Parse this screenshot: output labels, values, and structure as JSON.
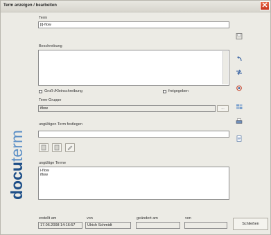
{
  "window": {
    "title": "Term anzeigen / bearbeiten",
    "close_label": "✕"
  },
  "logo": {
    "part1": "docu",
    "part2": "term"
  },
  "form": {
    "term_label": "Term",
    "term_value": "[i]-flow",
    "description_label": "Beschreibung",
    "description_value": "",
    "case_label": "Groß-/Kleinschreibung",
    "released_label": "freigegeben",
    "group_label": "Term-Gruppe",
    "group_value": "iflow",
    "group_browse_label": "...",
    "invalid_term_label": "ungültigen Term festlegen",
    "invalid_term_value": "",
    "invalid_terms_label": "ungültige Terme",
    "invalid_terms": [
      "i-flow",
      "iflow"
    ],
    "created_label": "erstellt am",
    "created_value": "17.06.2008 14:16:57",
    "created_by_label": "von",
    "created_by_value": "Ulrich Schmidt",
    "changed_label": "geändert am",
    "changed_value": "",
    "changed_by_label": "von",
    "changed_by_value": "",
    "close_button": "Schließen"
  },
  "toolbar_icons": [
    "save-icon",
    "undo-icon",
    "search-replace-icon",
    "refresh-icon",
    "term-list-icon",
    "print-icon",
    "export-icon"
  ],
  "colors": {
    "accent": "#1e4f88",
    "accent_light": "#5b8fc6",
    "close": "#c6341c"
  }
}
